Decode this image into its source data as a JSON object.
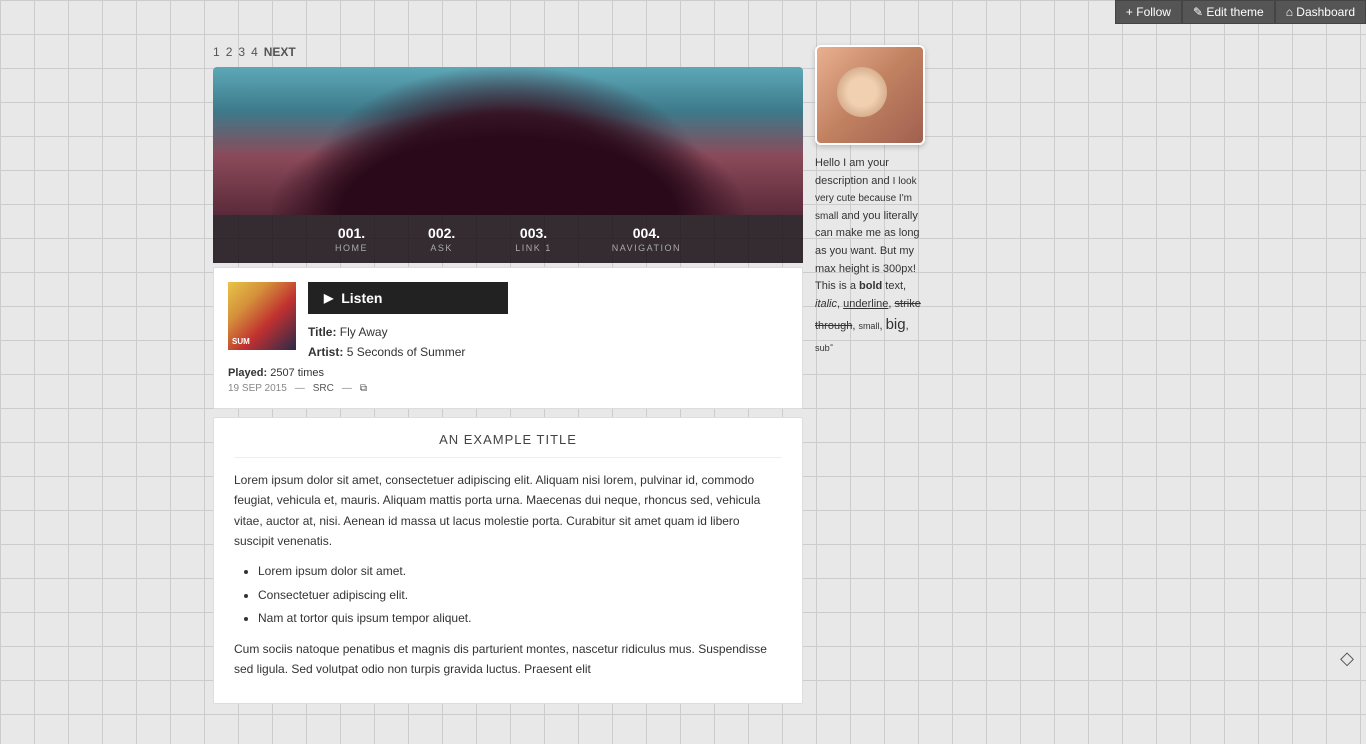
{
  "topbar": {
    "follow_label": "+ Follow",
    "edit_theme_label": "✎ Edit theme",
    "dashboard_label": "⌂ Dashboard"
  },
  "pagination": {
    "pages": [
      "1",
      "2",
      "3",
      "4"
    ],
    "next_label": "NEXT"
  },
  "nav": {
    "items": [
      {
        "number": "001.",
        "label": "HOME"
      },
      {
        "number": "002.",
        "label": "ASK"
      },
      {
        "number": "003.",
        "label": "LINK 1"
      },
      {
        "number": "004.",
        "label": "NAVIGATION"
      }
    ]
  },
  "music_player": {
    "play_button_label": "Listen",
    "title_label": "Title:",
    "title_value": "Fly Away",
    "artist_label": "Artist:",
    "artist_value": "5 Seconds of Summer",
    "played_label": "Played:",
    "played_value": "2507 times",
    "date": "19 SEP 2015",
    "src_label": "SRC",
    "separator": "—"
  },
  "post": {
    "title": "AN EXAMPLE TITLE",
    "body_paragraph1": "Lorem ipsum dolor sit amet, consectetuer adipiscing elit. Aliquam nisi lorem, pulvinar id, commodo feugiat, vehicula et, mauris. Aliquam mattis porta urna. Maecenas dui neque, rhoncus sed, vehicula vitae, auctor at, nisi. Aenean id massa ut lacus molestie porta. Curabitur sit amet quam id libero suscipit venenatis.",
    "list_items": [
      "Lorem ipsum dolor sit amet.",
      "Consectetuer adipiscing elit.",
      "Nam at tortor quis ipsum tempor aliquet."
    ],
    "body_paragraph2": "Cum sociis natoque penatibus et magnis dis parturient montes, nascetur ridiculus mus. Suspendisse sed ligula. Sed volutpat odio non turpis gravida luctus. Praesent elit"
  },
  "sidebar": {
    "description_parts": [
      {
        "text": "Hello I am your description and ",
        "style": "normal"
      },
      {
        "text": "I look very cute because I'm small",
        "style": "small"
      },
      {
        "text": " and you literally can make me as long as you want. But my max height is 300px! This is a ",
        "style": "normal"
      },
      {
        "text": "bold",
        "style": "bold"
      },
      {
        "text": " text, ",
        "style": "normal"
      },
      {
        "text": "italic",
        "style": "italic"
      },
      {
        "text": ", ",
        "style": "normal"
      },
      {
        "text": "underline",
        "style": "underline"
      },
      {
        "text": ", ",
        "style": "normal"
      },
      {
        "text": "strike through",
        "style": "strike"
      },
      {
        "text": ", ",
        "style": "normal"
      },
      {
        "text": "small",
        "style": "small"
      },
      {
        "text": ", ",
        "style": "normal"
      },
      {
        "text": "big",
        "style": "big"
      },
      {
        "text": ", ",
        "style": "normal"
      },
      {
        "text": "sub",
        "style": "sub"
      },
      {
        "text": "-",
        "style": "normal"
      }
    ]
  },
  "diamond": "◇"
}
